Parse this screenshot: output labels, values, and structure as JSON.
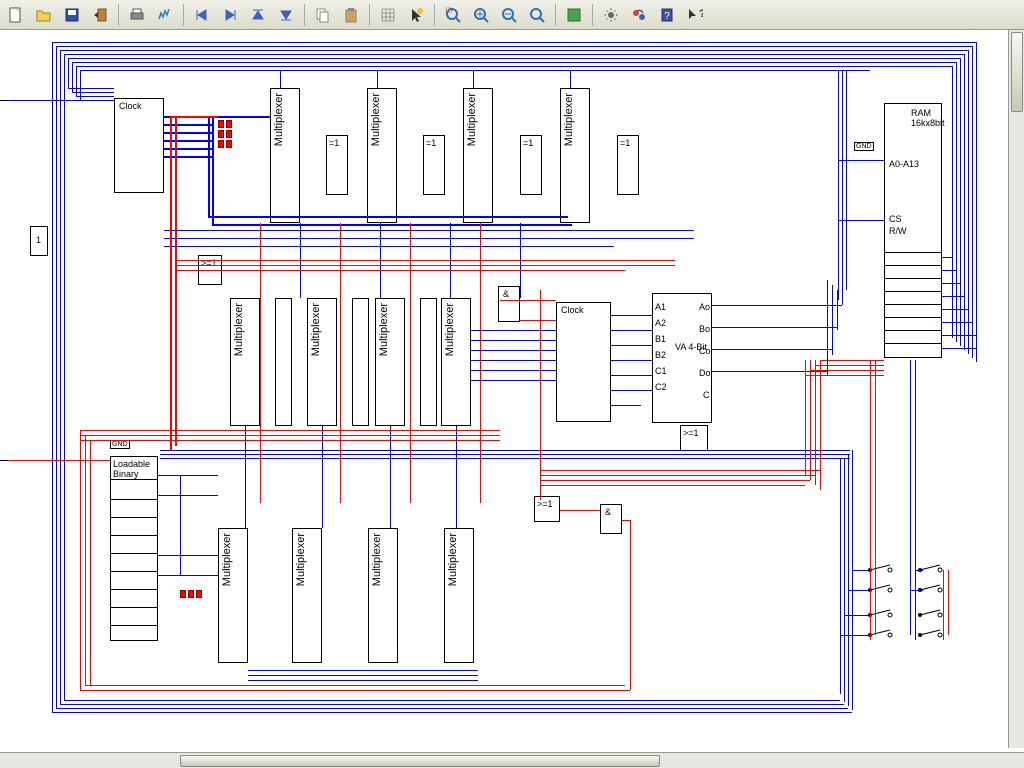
{
  "toolbar": {
    "new": "New",
    "open": "Open",
    "save": "Save",
    "exit": "Exit",
    "print": "Print",
    "plot": "Plot",
    "first": "First",
    "next": "Next",
    "up": "Up",
    "down": "Down",
    "copy": "Copy",
    "paste": "Paste",
    "grid": "Grid",
    "cursor": "Cursor",
    "zoomwin": "Zoom Window",
    "zoomin": "Zoom In",
    "zoomout": "Zoom Out",
    "zoomfit": "Zoom Fit",
    "run": "Run",
    "settings": "Settings",
    "sim": "Simulate",
    "help": "Help Book",
    "whatsthis": "?"
  },
  "components": {
    "clock1": "Clock",
    "clock2": "Clock",
    "mux": "Multiplexer",
    "xor": "=1",
    "or": ">=1",
    "and": "&",
    "one": "1",
    "gnd": "GND",
    "loadable": "Loadable Binary",
    "ram": "RAM 16kx8bit",
    "ram_addr": "A0-A13",
    "ram_cs": "CS",
    "ram_rw": "R/W",
    "va": "VA 4-Bit",
    "va_a1": "A1",
    "va_a2": "A2",
    "va_b1": "B1",
    "va_b2": "B2",
    "va_c1": "C1",
    "va_c2": "C2",
    "va_ao": "Ao",
    "va_bo": "Bo",
    "va_co": "Co",
    "va_do": "Do",
    "va_c": "C"
  }
}
